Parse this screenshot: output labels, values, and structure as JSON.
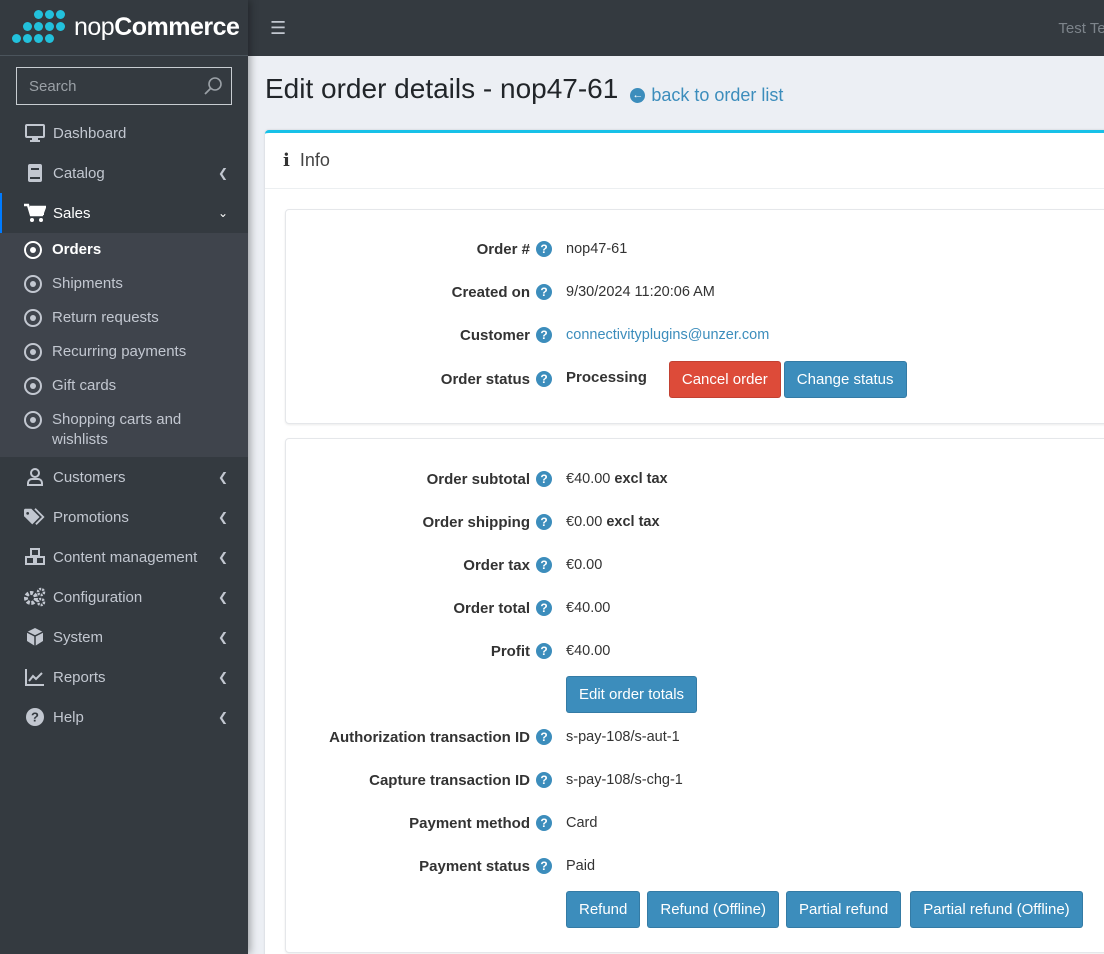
{
  "brand": {
    "prefix": "nop",
    "suffix": "Commerce"
  },
  "search": {
    "placeholder": "Search"
  },
  "sidebar": {
    "items": [
      {
        "label": "Dashboard",
        "icon": "monitor-icon"
      },
      {
        "label": "Catalog",
        "icon": "book-icon"
      },
      {
        "label": "Sales",
        "icon": "cart-icon"
      },
      {
        "label": "Customers",
        "icon": "user-icon"
      },
      {
        "label": "Promotions",
        "icon": "tags-icon"
      },
      {
        "label": "Content management",
        "icon": "cubes-icon"
      },
      {
        "label": "Configuration",
        "icon": "gears-icon"
      },
      {
        "label": "System",
        "icon": "cube-icon"
      },
      {
        "label": "Reports",
        "icon": "chart-line-icon"
      },
      {
        "label": "Help",
        "icon": "question-circle-icon"
      }
    ],
    "sales_sub": [
      {
        "label": "Orders"
      },
      {
        "label": "Shipments"
      },
      {
        "label": "Return requests"
      },
      {
        "label": "Recurring payments"
      },
      {
        "label": "Gift cards"
      },
      {
        "label": "Shopping carts and wishlists"
      }
    ]
  },
  "topbar": {
    "user": "Test Tea"
  },
  "page": {
    "title": "Edit order details - nop47-61",
    "back_link": "back to order list",
    "card_title": "Info"
  },
  "order": {
    "number_label": "Order #",
    "number": "nop47-61",
    "created_label": "Created on",
    "created": "9/30/2024 11:20:06 AM",
    "customer_label": "Customer",
    "customer": "connectivityplugins@unzer.com",
    "status_label": "Order status",
    "status": "Processing",
    "cancel_button": "Cancel order",
    "change_status_button": "Change status"
  },
  "totals": {
    "subtotal_label": "Order subtotal",
    "subtotal": "€40.00",
    "subtotal_suffix": "excl tax",
    "shipping_label": "Order shipping",
    "shipping": "€0.00",
    "shipping_suffix": "excl tax",
    "tax_label": "Order tax",
    "tax": "€0.00",
    "total_label": "Order total",
    "total": "€40.00",
    "profit_label": "Profit",
    "profit": "€40.00",
    "edit_totals_button": "Edit order totals",
    "auth_label": "Authorization transaction ID",
    "auth": "s-pay-108/s-aut-1",
    "capture_label": "Capture transaction ID",
    "capture": "s-pay-108/s-chg-1",
    "method_label": "Payment method",
    "method": "Card",
    "pstatus_label": "Payment status",
    "pstatus": "Paid",
    "refund_buttons": [
      "Refund",
      "Refund (Offline)",
      "Partial refund",
      "Partial refund (Offline)"
    ]
  },
  "help_glyph": "?"
}
